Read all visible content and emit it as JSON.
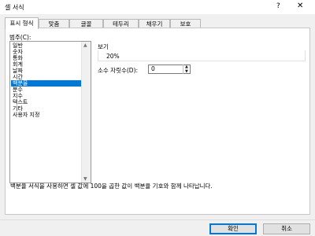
{
  "window": {
    "title": "셀 서식",
    "help_glyph": "?",
    "close_glyph": "✕"
  },
  "tabs": [
    "표시 형식",
    "맞춤",
    "글꼴",
    "테두리",
    "채우기",
    "보호"
  ],
  "category": {
    "label": "범주(C):",
    "items": [
      "일반",
      "숫자",
      "통화",
      "회계",
      "날짜",
      "시간",
      "백분율",
      "분수",
      "지수",
      "텍스트",
      "기타",
      "사용자 지정"
    ],
    "selected": "백분율"
  },
  "sample": {
    "label": "보기",
    "value": "20%"
  },
  "decimal_places": {
    "label": "소수 자릿수(D):",
    "value": "0"
  },
  "description": "백분율 서식을 사용하면 셀 값에 100을 곱한 값이 백분율 기호와 함께 나타납니다.",
  "buttons": {
    "ok": "확인",
    "cancel": "취소"
  }
}
